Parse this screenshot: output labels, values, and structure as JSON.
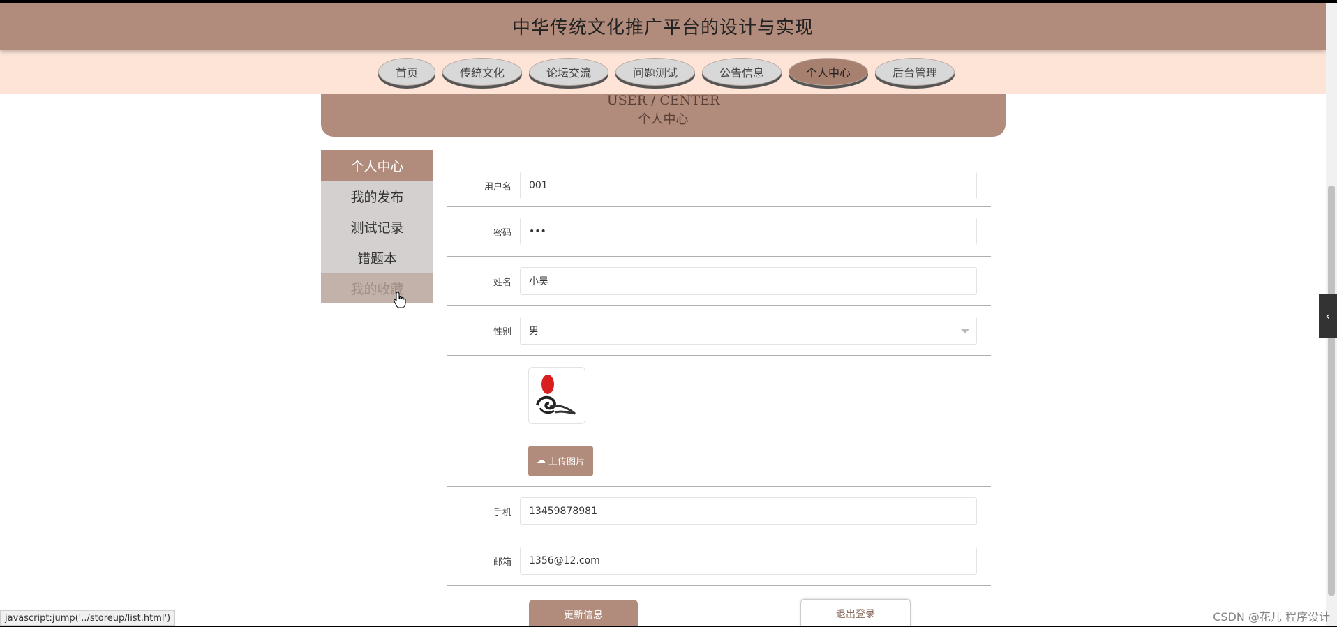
{
  "header": {
    "title": "中华传统文化推广平台的设计与实现"
  },
  "nav": {
    "items": [
      {
        "label": "首页"
      },
      {
        "label": "传统文化"
      },
      {
        "label": "论坛交流"
      },
      {
        "label": "问题测试"
      },
      {
        "label": "公告信息"
      },
      {
        "label": "个人中心",
        "active": true
      },
      {
        "label": "后台管理"
      }
    ]
  },
  "banner": {
    "en": "USER / CENTER",
    "cn": "个人中心"
  },
  "sidemenu": {
    "items": [
      {
        "label": "个人中心",
        "state": "active"
      },
      {
        "label": "我的发布"
      },
      {
        "label": "测试记录"
      },
      {
        "label": "错题本"
      },
      {
        "label": "我的收藏",
        "state": "hover"
      }
    ]
  },
  "form": {
    "username": {
      "label": "用户名",
      "value": "001"
    },
    "password": {
      "label": "密码",
      "value": "•••"
    },
    "name": {
      "label": "姓名",
      "value": "小吴"
    },
    "gender": {
      "label": "性别",
      "value": "男"
    },
    "upload_label": "上传图片",
    "phone": {
      "label": "手机",
      "value": "13459878981"
    },
    "email": {
      "label": "邮箱",
      "value": "1356@12.com"
    }
  },
  "buttons": {
    "update": "更新信息",
    "logout": "退出登录"
  },
  "status": {
    "link": "javascript:jump('../storeup/list.html')"
  },
  "watermark": "CSDN @花儿 程序设计",
  "colors": {
    "brand": "#b18b7b",
    "nav_bg": "#fde4d6",
    "side_bg": "#d4d0cf"
  }
}
